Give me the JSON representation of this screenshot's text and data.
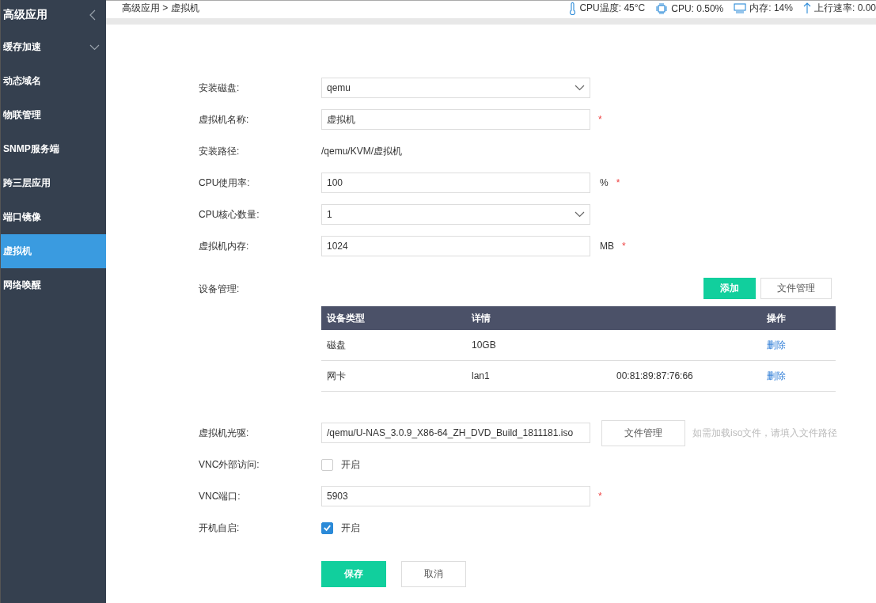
{
  "sidebar": {
    "title": "高级应用",
    "items": [
      {
        "label": "缓存加速",
        "selected": false,
        "expandable": true
      },
      {
        "label": "动态域名",
        "selected": false,
        "expandable": false
      },
      {
        "label": "物联管理",
        "selected": false,
        "expandable": false
      },
      {
        "label": "SNMP服务端",
        "selected": false,
        "expandable": false
      },
      {
        "label": "跨三层应用",
        "selected": false,
        "expandable": false
      },
      {
        "label": "端口镜像",
        "selected": false,
        "expandable": false
      },
      {
        "label": "虚拟机",
        "selected": true,
        "expandable": false
      },
      {
        "label": "网络唤醒",
        "selected": false,
        "expandable": false
      }
    ]
  },
  "breadcrumb": "高级应用 > 虚拟机",
  "status_bar": [
    {
      "kind": "temperature",
      "text": "CPU温度: 45°C"
    },
    {
      "kind": "cpu",
      "text": "CPU: 0.50%"
    },
    {
      "kind": "memory",
      "text": "内存: 14%"
    },
    {
      "kind": "upload",
      "text": "上行速率: 0.00"
    }
  ],
  "form": [
    {
      "kind": "select",
      "label": "安装磁盘:",
      "value": "qemu"
    },
    {
      "kind": "input",
      "label": "虚拟机名称:",
      "value": "虚拟机",
      "required_mark": "*"
    },
    {
      "kind": "text",
      "label": "安装路径:",
      "value": "/qemu/KVM/虚拟机"
    },
    {
      "kind": "input",
      "label": "CPU使用率:",
      "value": "100",
      "unit": "%",
      "required_mark": "*"
    },
    {
      "kind": "select",
      "label": "CPU核心数量:",
      "value": "1"
    },
    {
      "kind": "input",
      "label": "虚拟机内存:",
      "value": "1024",
      "unit": "MB",
      "required_mark": "*"
    }
  ],
  "devices": {
    "label": "设备管理:",
    "add_button": "添加",
    "file_button": "文件管理",
    "columns": [
      "设备类型",
      "详情",
      "操作"
    ],
    "rows": [
      {
        "type": "磁盘",
        "detail": "10GB",
        "action": "删除"
      },
      {
        "type": "网卡",
        "detail": "lan1",
        "extra": "00:81:89:87:76:66",
        "action": "删除"
      }
    ]
  },
  "form2": [
    {
      "kind": "file",
      "label": "虚拟机光驱:",
      "value": "/qemu/U-NAS_3.0.9_X86-64_ZH_DVD_Build_1811181.iso",
      "button": "文件管理",
      "hint": "如需加载iso文件，请填入文件路径"
    },
    {
      "kind": "checkbox",
      "label": "VNC外部访问:",
      "text": "开启",
      "checked": false
    },
    {
      "kind": "input",
      "label": "VNC端口:",
      "value": "5903",
      "required_mark": "*"
    },
    {
      "kind": "checkbox",
      "label": "开机自启:",
      "text": "开启",
      "checked": true
    }
  ],
  "buttons": {
    "save": "保存",
    "cancel": "取消"
  }
}
